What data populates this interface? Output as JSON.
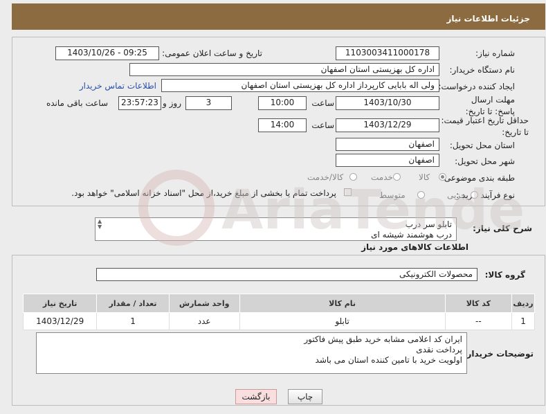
{
  "header": {
    "title": "جزئیات اطلاعات نیاز"
  },
  "info": {
    "need_number_label": "شماره نیاز:",
    "need_number": "1103003411000178",
    "announce_label": "تاریخ و ساعت اعلان عمومی:",
    "announce_value": "1403/10/26 - 09:25",
    "buyer_org_label": "نام دستگاه خریدار:",
    "buyer_org": "اداره کل بهزیستی استان اصفهان",
    "requester_label": "ایجاد کننده درخواست:",
    "requester": "ولی اله بابایی کارپرداز اداره کل بهزیستی استان اصفهان",
    "contact_link": "اطلاعات تماس خریدار",
    "deadline_label": "مهلت ارسال پاسخ: تا تاریخ:",
    "deadline_date": "1403/10/30",
    "time_label": "ساعت",
    "deadline_time": "10:00",
    "days_value": "3",
    "days_label": "روز و",
    "remaining_time": "23:57:23",
    "remaining_label": "ساعت باقی مانده",
    "validity_label": "حداقل تاریخ اعتبار قیمت: تا تاریخ:",
    "validity_date": "1403/12/29",
    "validity_time": "14:00",
    "province_label": "استان محل تحویل:",
    "province": "اصفهان",
    "city_label": "شهر محل تحویل:",
    "city": "اصفهان",
    "category_label": "طبقه بندی موضوعی:",
    "category_options": [
      "کالا",
      "خدمت",
      "کالا/خدمت"
    ],
    "process_label": "نوع فرآیند خرید :",
    "process_options": [
      "جزیی",
      "متوسط"
    ],
    "payment_note": "پرداخت تمام یا بخشی از مبلغ خرید،از محل \"اسناد خزانه اسلامی\" خواهد بود."
  },
  "description": {
    "label": "شرح کلی نیاز:",
    "text": "تابلو سر درب\nدرب هوشمند شیشه ای"
  },
  "goods": {
    "section_title": "اطلاعات کالاهای مورد نیاز",
    "group_label": "گروه کالا:",
    "group_value": "محصولات الکترونیکی",
    "columns": [
      "ردیف",
      "کد کالا",
      "نام کالا",
      "واحد شمارش",
      "تعداد / مقدار",
      "تاریخ نیاز"
    ],
    "rows": [
      [
        "1",
        "--",
        "تابلو",
        "عدد",
        "1",
        "1403/12/29"
      ]
    ]
  },
  "buyer_notes": {
    "label": "توضیحات خریدار:",
    "text": "ایران کد اعلامی مشابه خرید طبق پیش فاکتور\nپرداخت نقدی\nاولویت خرید با تامین کننده استان می باشد"
  },
  "buttons": {
    "print": "چاپ",
    "back": "بازگشت"
  },
  "watermark": "AriaTender.neT"
}
